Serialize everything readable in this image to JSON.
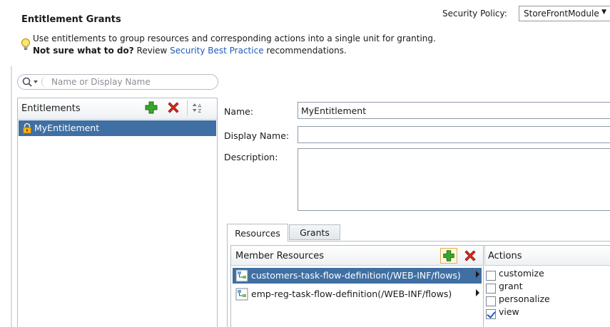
{
  "header": {
    "title": "Entitlement Grants",
    "security_policy_label": "Security Policy:",
    "security_policy_value": "StoreFrontModule"
  },
  "hint": {
    "line1": "Use entitlements to group resources and corresponding actions into a single unit for granting.",
    "line2_bold": "Not sure what to do?",
    "line2_pre": " Review ",
    "line2_link": "Security Best Practice",
    "line2_post": " recommendations."
  },
  "search": {
    "placeholder": "Name or Display Name"
  },
  "entitlements": {
    "header": "Entitlements",
    "items": [
      {
        "label": "MyEntitlement",
        "selected": true
      }
    ]
  },
  "form": {
    "name_label": "Name:",
    "name_value": "MyEntitlement",
    "display_name_label": "Display Name:",
    "display_name_value": "",
    "description_label": "Description:",
    "description_value": ""
  },
  "tabs": [
    {
      "label": "Resources",
      "active": true
    },
    {
      "label": "Grants",
      "active": false
    }
  ],
  "member_resources": {
    "header": "Member Resources",
    "items": [
      {
        "label": "customers-task-flow-definition(/WEB-INF/flows)",
        "selected": true
      },
      {
        "label": "emp-reg-task-flow-definition(/WEB-INF/flows)",
        "selected": false
      }
    ]
  },
  "actions": {
    "header": "Actions",
    "items": [
      {
        "label": "customize",
        "checked": false
      },
      {
        "label": "grant",
        "checked": false
      },
      {
        "label": "personalize",
        "checked": false
      },
      {
        "label": "view",
        "checked": true
      }
    ]
  },
  "colors": {
    "selection": "#3f6fa3",
    "link": "#1e5bb8",
    "add_icon": "#3aa52c",
    "delete_icon": "#d82b1f"
  }
}
